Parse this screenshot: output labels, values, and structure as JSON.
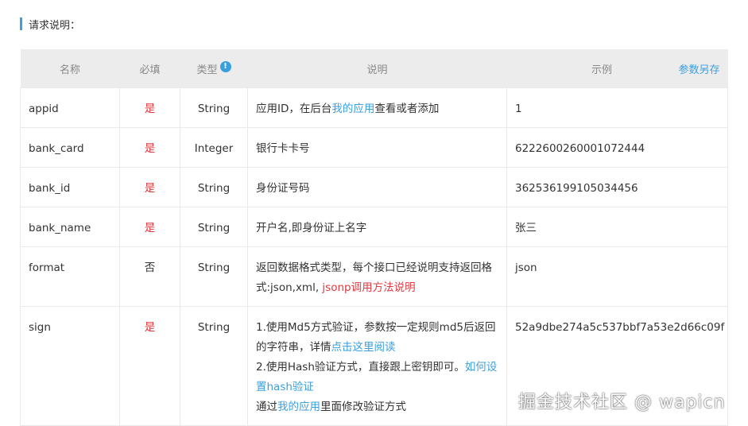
{
  "section_title": "请求说明：",
  "headers": {
    "name": "名称",
    "required": "必填",
    "type": "类型",
    "desc": "说明",
    "example": "示例",
    "save": "参数另存"
  },
  "rows": [
    {
      "name": "appid",
      "required": "是",
      "type": "String",
      "desc": [
        {
          "t": "应用ID，在后台"
        },
        {
          "t": "我的应用",
          "c": "link"
        },
        {
          "t": "查看或者添加"
        }
      ],
      "example": "1"
    },
    {
      "name": "bank_card",
      "required": "是",
      "type": "Integer",
      "desc": [
        {
          "t": "银行卡卡号"
        }
      ],
      "example": "6222600260001072444"
    },
    {
      "name": "bank_id",
      "required": "是",
      "type": "String",
      "desc": [
        {
          "t": "身份证号码"
        }
      ],
      "example": "362536199105034456"
    },
    {
      "name": "bank_name",
      "required": "是",
      "type": "String",
      "desc": [
        {
          "t": "开户名,即身份证上名字"
        }
      ],
      "example": "张三"
    },
    {
      "name": "format",
      "required": "否",
      "type": "String",
      "desc": [
        {
          "t": "返回数据格式类型，每个接口已经说明支持返回格式:json,xml, "
        },
        {
          "t": "jsonp调用方法说明",
          "c": "red"
        }
      ],
      "example": "json"
    },
    {
      "name": "sign",
      "required": "是",
      "type": "String",
      "desc": [
        {
          "t": "1.使用Md5方式验证，参数按一定规则md5后返回的字符串，详情"
        },
        {
          "t": "点击这里阅读",
          "c": "link"
        },
        {
          "br": true
        },
        {
          "t": "2.使用Hash验证方式，直接跟上密钥即可。"
        },
        {
          "t": "如何设置hash验证",
          "c": "link"
        },
        {
          "br": true
        },
        {
          "t": "通过"
        },
        {
          "t": "我的应用",
          "c": "link"
        },
        {
          "t": "里面修改验证方式"
        }
      ],
      "example": "52a9dbe274a5c537bbf7a53e2d66c09f"
    }
  ],
  "watermark": "掘金技术社区 @ wapicn",
  "colors": {
    "accent": "#3a9fde",
    "required": "#e0393e"
  }
}
